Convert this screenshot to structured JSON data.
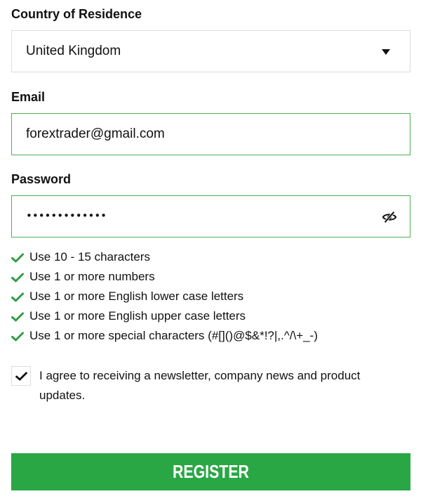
{
  "form": {
    "country": {
      "label": "Country of Residence",
      "value": "United Kingdom"
    },
    "email": {
      "label": "Email",
      "value": "forextrader@gmail.com"
    },
    "password": {
      "label": "Password",
      "masked_value": "•••••••••••••",
      "toggle_icon": "eye-slash-icon"
    },
    "password_rules": [
      "Use 10 - 15 characters",
      "Use 1 or more numbers",
      "Use 1 or more English lower case letters",
      "Use 1 or more English upper case letters",
      "Use 1 or more special characters (#[]()@$&*!?|,.^/\\+_-)"
    ],
    "newsletter": {
      "checked": true,
      "label": "I agree to receiving a newsletter, company news and product updates."
    },
    "submit_label": "REGISTER"
  },
  "colors": {
    "accent_green": "#29a745",
    "valid_border": "#4caf50",
    "check_green": "#2e9d44",
    "field_border": "#dddddd"
  }
}
